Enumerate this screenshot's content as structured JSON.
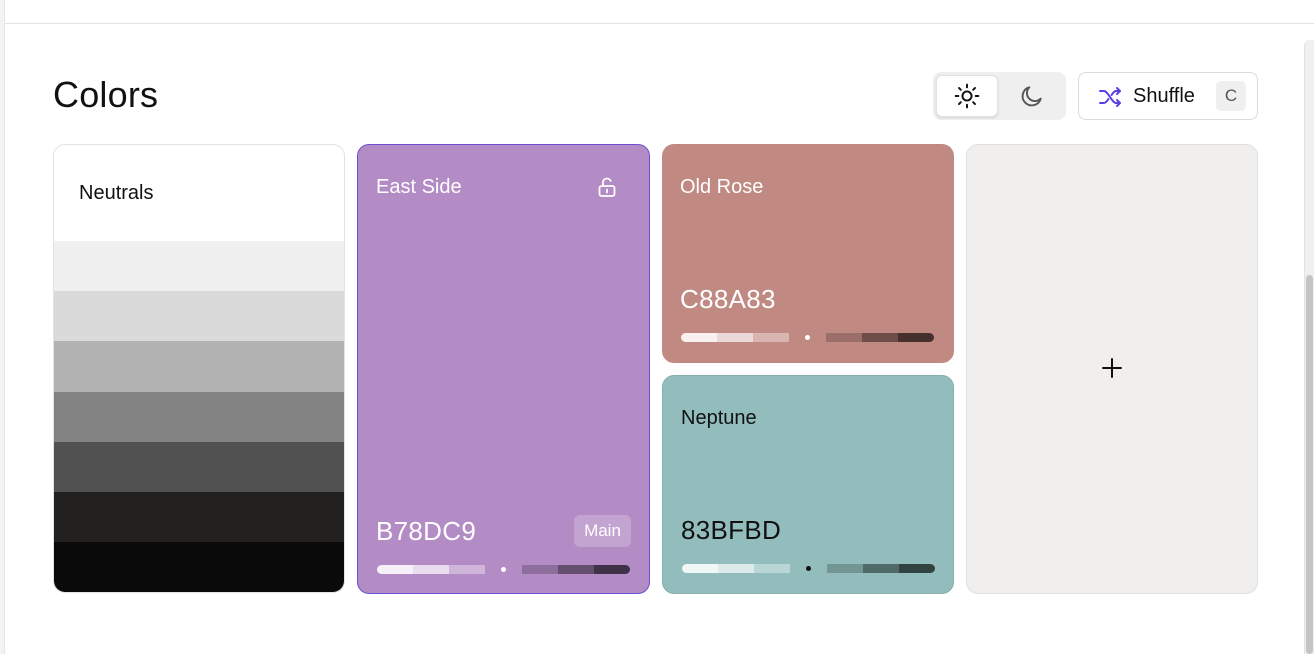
{
  "header": {
    "title": "Colors",
    "theme_toggle": {
      "light_icon": "sun-icon",
      "dark_icon": "moon-icon",
      "selected": "light"
    },
    "shuffle": {
      "label": "Shuffle",
      "shortcut": "C",
      "icon": "shuffle-icon",
      "icon_color": "#5b3fe0"
    }
  },
  "neutrals": {
    "title": "Neutrals",
    "shades": [
      "#ffffff",
      "#f0f0f0",
      "#dadada",
      "#b2b2b2",
      "#838383",
      "#515151",
      "#222120",
      "#0b0a0a"
    ]
  },
  "palette": [
    {
      "name": "East Side",
      "hex": "B78DC9",
      "color": "#b48cc5",
      "text_color": "#ffffff",
      "locked": false,
      "lock_icon": "unlock-icon",
      "badge": "Main",
      "scale": [
        "#f6f1f8",
        "#e9dcef",
        "#cfb5da",
        "#b48cc5",
        "#8e6e9d",
        "#644e6f",
        "#3f3147"
      ],
      "scale_marker_index": 3
    },
    {
      "name": "Old Rose",
      "hex": "C88A83",
      "color": "#c08a83",
      "text_color": "#ffffff",
      "scale": [
        "#f8f1f0",
        "#ecdad8",
        "#d9b4b0",
        "#c08a83",
        "#9b6e69",
        "#6e4c48",
        "#45302d"
      ],
      "scale_marker_index": 3
    },
    {
      "name": "Neptune",
      "hex": "83BFBD",
      "color": "#93bdbd",
      "text_color": "#111111",
      "scale": [
        "#f1f7f7",
        "#dceaea",
        "#b7d6d5",
        "#93bdbd",
        "#739594",
        "#506a69",
        "#324241"
      ],
      "scale_marker_index": 3
    }
  ],
  "add_card": {
    "icon": "plus-icon"
  }
}
